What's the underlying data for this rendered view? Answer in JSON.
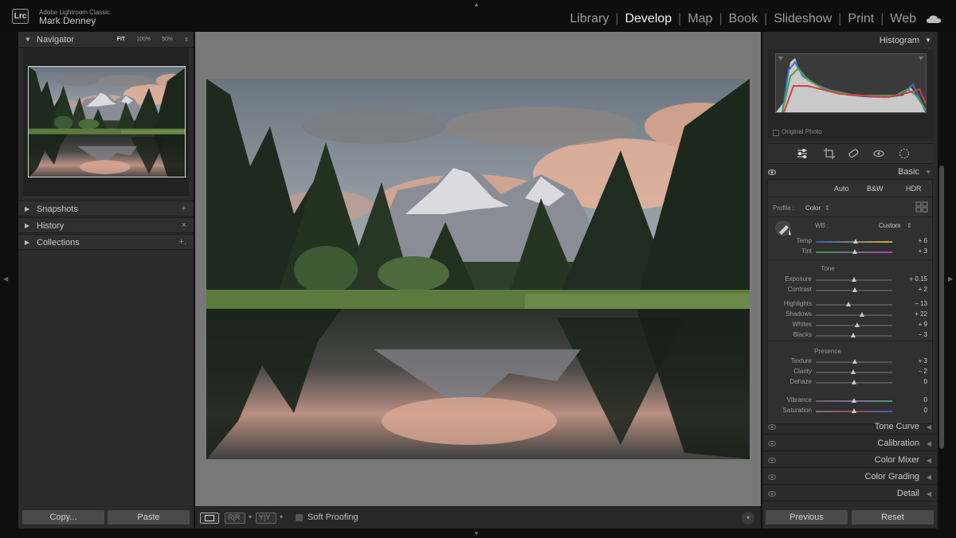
{
  "header": {
    "logo_text": "Lrc",
    "app_name": "Adobe Lightroom Classic",
    "user_name": "Mark Denney",
    "modules": [
      "Library",
      "Develop",
      "Map",
      "Book",
      "Slideshow",
      "Print",
      "Web"
    ],
    "active_module": "Develop"
  },
  "left_panel": {
    "navigator": {
      "title": "Navigator",
      "zoom_options": [
        "FIT",
        "100%",
        "50%"
      ],
      "active_zoom": "FIT"
    },
    "sections": [
      {
        "title": "Snapshots",
        "action": "+"
      },
      {
        "title": "History",
        "action": "×"
      },
      {
        "title": "Collections",
        "action": "+."
      }
    ],
    "copy_label": "Copy...",
    "paste_label": "Paste"
  },
  "toolbar": {
    "soft_proofing_label": "Soft Proofing"
  },
  "right_panel": {
    "histogram": {
      "title": "Histogram",
      "original_photo_label": "Original Photo"
    },
    "tools": [
      "edit-sliders",
      "crop",
      "healing",
      "red-eye",
      "masking"
    ],
    "basic": {
      "title": "Basic",
      "modes": [
        "Auto",
        "B&W",
        "HDR"
      ],
      "profile_label": "Profile :",
      "profile_value": "Color",
      "wb_label": "WB :",
      "wb_value": "Custom",
      "tone_label": "Tone",
      "presence_label": "Presence",
      "wb_sliders": [
        {
          "label": "Temp",
          "value": "+ 6",
          "pos": 0.52
        },
        {
          "label": "Tint",
          "value": "+ 3",
          "pos": 0.51
        }
      ],
      "tone_sliders_a": [
        {
          "label": "Exposure",
          "value": "+ 0.15",
          "pos": 0.5
        },
        {
          "label": "Contrast",
          "value": "+ 2",
          "pos": 0.51
        }
      ],
      "tone_sliders_b": [
        {
          "label": "Highlights",
          "value": "− 13",
          "pos": 0.43
        },
        {
          "label": "Shadows",
          "value": "+ 22",
          "pos": 0.6
        },
        {
          "label": "Whites",
          "value": "+ 9",
          "pos": 0.54
        },
        {
          "label": "Blacks",
          "value": "− 3",
          "pos": 0.49
        }
      ],
      "presence_sliders_a": [
        {
          "label": "Texture",
          "value": "+ 3",
          "pos": 0.51
        },
        {
          "label": "Clarity",
          "value": "− 2",
          "pos": 0.49
        },
        {
          "label": "Dehaze",
          "value": "0",
          "pos": 0.5
        }
      ],
      "presence_sliders_b": [
        {
          "label": "Vibrance",
          "value": "0",
          "pos": 0.5
        },
        {
          "label": "Saturation",
          "value": "0",
          "pos": 0.5
        }
      ]
    },
    "collapsed_sections": [
      "Tone Curve",
      "Calibration",
      "Color Mixer",
      "Color Grading",
      "Detail"
    ],
    "previous_label": "Previous",
    "reset_label": "Reset"
  },
  "colors": {
    "panel_bg": "#2b2b2b",
    "canvas_bg": "#787878",
    "active_text": "#f0f0f0"
  }
}
